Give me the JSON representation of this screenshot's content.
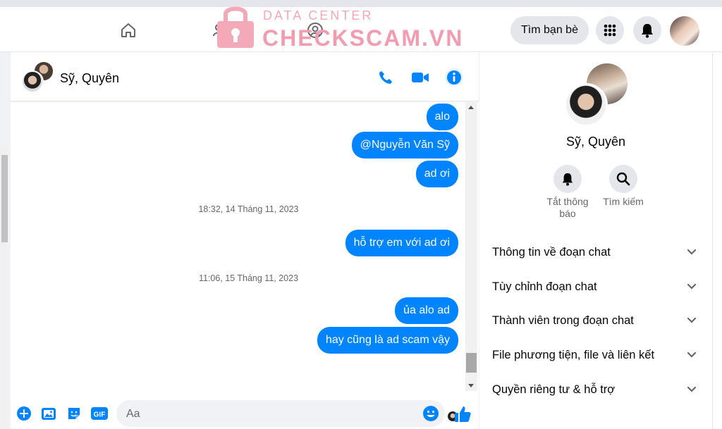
{
  "watermark": {
    "line1": "DATA CENTER",
    "line2": "CHECKSCAM.VN"
  },
  "topbar": {
    "find_friends": "Tìm bạn bè",
    "icons": [
      "home-icon",
      "friends-icon",
      "profile-icon",
      "apps-grid-icon",
      "bell-icon"
    ]
  },
  "chat": {
    "title": "Sỹ, Quyên",
    "messages": [
      {
        "text": "alo"
      },
      {
        "text": "@Nguyễn Văn Sỹ"
      },
      {
        "text": "ad ơi"
      },
      {
        "text": "hỗ trợ em với ad ơi"
      },
      {
        "text": "ủa alo ad"
      },
      {
        "text": "hay cũng là ad scam vậy"
      }
    ],
    "timestamps": [
      "18:32, 14 Tháng 11, 2023",
      "11:06, 15 Tháng 11, 2023"
    ]
  },
  "composer": {
    "placeholder": "Aa",
    "gif": "GIF"
  },
  "info": {
    "name": "Sỹ, Quyên",
    "mute": "Tắt thông báo",
    "search": "Tìm kiếm",
    "sections": [
      "Thông tin về đoạn chat",
      "Tùy chỉnh đoạn chat",
      "Thành viên trong đoạn chat",
      "File phương tiện, file và liên kết",
      "Quyền riêng tư & hỗ trợ"
    ]
  },
  "colors": {
    "accent": "#0084ff",
    "bubble_text": "#ffffff",
    "watermark": "#f39cb0"
  }
}
